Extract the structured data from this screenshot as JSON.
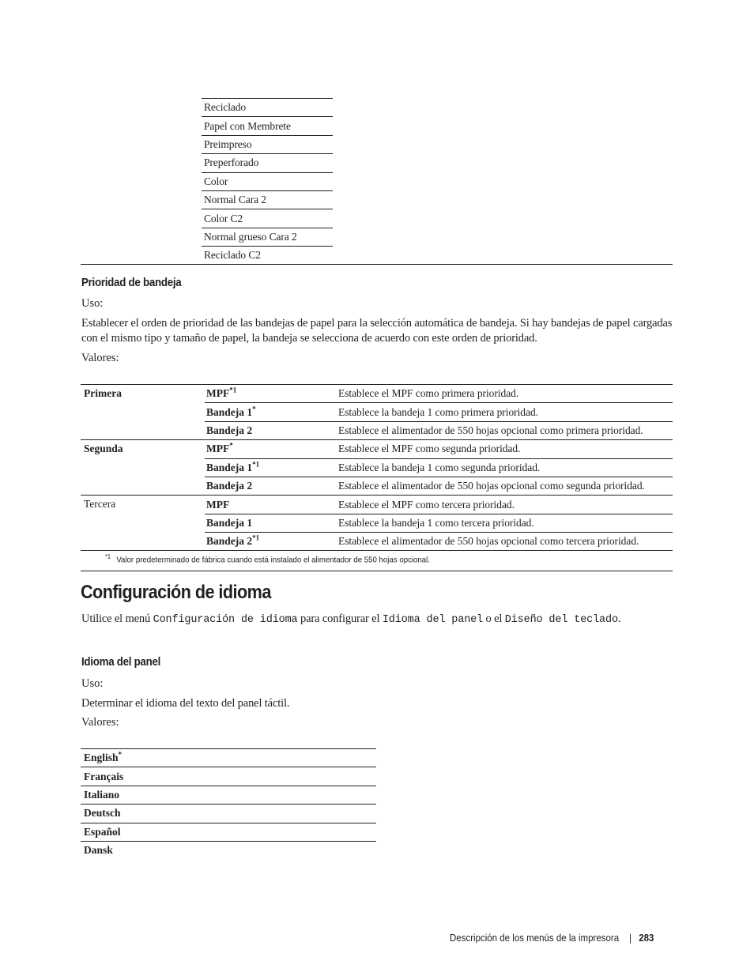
{
  "continuation_table": {
    "items": [
      "Reciclado",
      "Papel con Membrete",
      "Preimpreso",
      "Preperforado",
      "Color",
      "Normal Cara 2",
      "Color C2",
      "Normal grueso Cara 2",
      "Reciclado C2"
    ]
  },
  "tray_priority": {
    "heading": "Prioridad de bandeja",
    "usage_label": "Uso:",
    "usage_text": "Establecer el orden de prioridad de las bandejas de papel para la selección automática de bandeja. Si hay bandejas de papel cargadas con el mismo tipo y tamaño de papel, la bandeja se selecciona de acuerdo con este orden de prioridad.",
    "values_label": "Valores:",
    "groups": [
      {
        "name": "Primera",
        "rows": [
          {
            "value": "MPF",
            "mark": "*1",
            "description": "Establece el MPF como primera prioridad."
          },
          {
            "value": "Bandeja 1",
            "mark": "*",
            "description": "Establece la bandeja 1 como primera prioridad."
          },
          {
            "value": "Bandeja 2",
            "mark": "",
            "description": "Establece el alimentador de 550 hojas opcional como primera prioridad."
          }
        ]
      },
      {
        "name": "Segunda",
        "rows": [
          {
            "value": "MPF",
            "mark": "*",
            "description": "Establece el MPF como segunda prioridad."
          },
          {
            "value": "Bandeja 1",
            "mark": "*1",
            "description": "Establece la bandeja 1 como segunda prioridad."
          },
          {
            "value": "Bandeja 2",
            "mark": "",
            "description": "Establece el alimentador de 550 hojas opcional como segunda prioridad."
          }
        ]
      },
      {
        "name": "Tercera",
        "rows": [
          {
            "value": "MPF",
            "mark": "",
            "description": "Establece el MPF como tercera prioridad."
          },
          {
            "value": "Bandeja 1",
            "mark": "",
            "description": "Establece la bandeja 1 como tercera prioridad."
          },
          {
            "value": "Bandeja 2",
            "mark": "*1",
            "description": "Establece el alimentador de 550 hojas opcional como tercera prioridad."
          }
        ]
      }
    ],
    "footnote": {
      "mark": "*1",
      "text": "Valor predeterminado de fábrica cuando está instalado el alimentador de 550 hojas opcional."
    }
  },
  "language_config": {
    "heading": "Configuración de idioma",
    "intro": {
      "pre": "Utilice el menú ",
      "menu": "Configuración de idioma",
      "mid": " para configurar el ",
      "item1": "Idioma del panel",
      "or": " o el ",
      "item2": "Diseño del teclado",
      "end": "."
    }
  },
  "panel_language": {
    "heading": "Idioma del panel",
    "usage_label": "Uso:",
    "usage_text": "Determinar el idioma del texto del panel táctil.",
    "values_label": "Valores:",
    "options": [
      {
        "label": "English",
        "mark": "*"
      },
      {
        "label": "Français",
        "mark": ""
      },
      {
        "label": "Italiano",
        "mark": ""
      },
      {
        "label": "Deutsch",
        "mark": ""
      },
      {
        "label": "Español",
        "mark": ""
      },
      {
        "label": "Dansk",
        "mark": ""
      }
    ]
  },
  "footer": {
    "section": "Descripción de los menús de la impresora",
    "separator": "|",
    "page_number": "283"
  }
}
